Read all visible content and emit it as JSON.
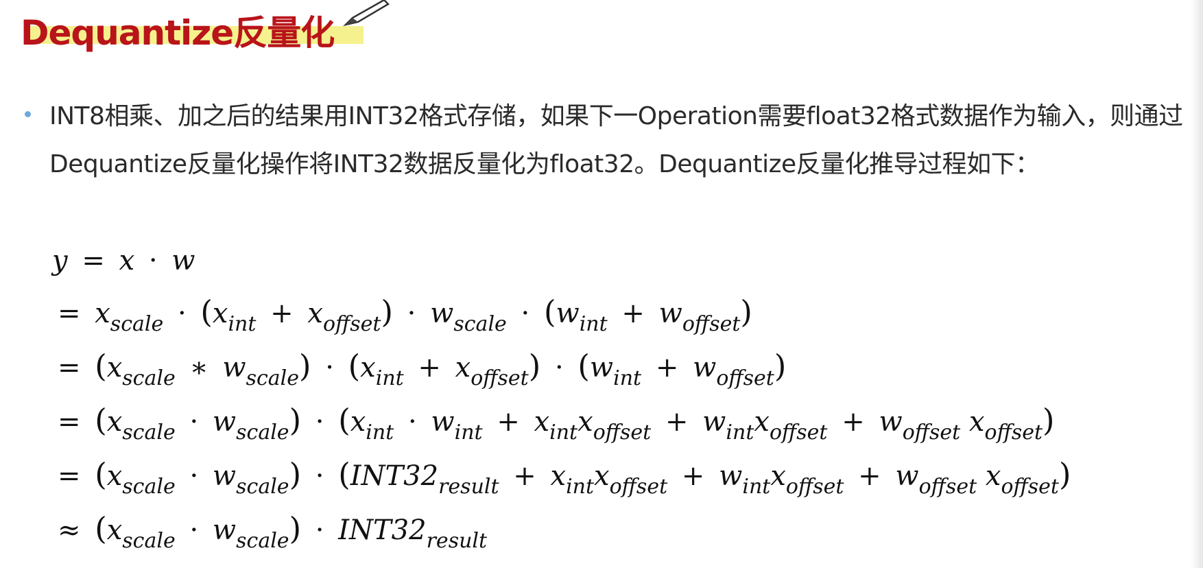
{
  "title": "Dequantize反量化",
  "bullet": {
    "text": "INT8相乘、加之后的结果用INT32格式存储，如果下一Operation需要float32格式数据作为输入，则通过Dequantize反量化操作将INT32数据反量化为float32。Dequantize反量化推导过程如下："
  },
  "equations": {
    "y": "y",
    "x": "x",
    "w": "w",
    "scale": "scale",
    "int": "int",
    "offset": "offset",
    "result": "result",
    "int32": "INT32",
    "eq": "=",
    "approx": "≈",
    "dot": "·",
    "plus": "+",
    "star": "∗",
    "lparen": "(",
    "rparen": ")"
  },
  "colors": {
    "title": "#b8141a",
    "highlight": "#f3ef7a",
    "bullet": "#6fa8dc",
    "text": "#2a2a2a"
  }
}
